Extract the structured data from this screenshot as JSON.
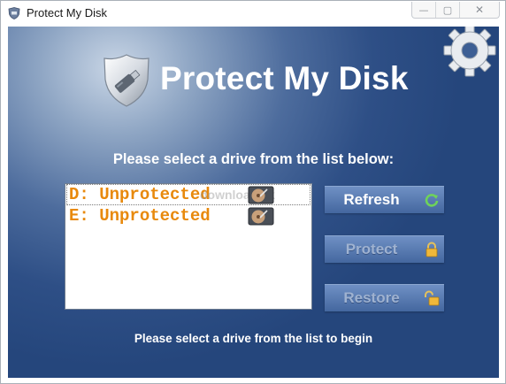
{
  "window": {
    "title": "Protect My Disk",
    "minimize_glyph": "—",
    "maximize_glyph": "▢",
    "close_glyph": "✕"
  },
  "header": {
    "app_name": "Protect My Disk",
    "logo_icon": "shield-usb-icon",
    "settings_icon": "gear-icon"
  },
  "main": {
    "instruction": "Please select a drive from the list below:",
    "drives": [
      {
        "label": "D: Unprotected",
        "icon": "hard-drive-icon",
        "selected": true
      },
      {
        "label": "E: Unprotected",
        "icon": "hard-drive-icon",
        "selected": false
      }
    ],
    "watermark": "download.sk",
    "buttons": {
      "refresh": {
        "label": "Refresh",
        "icon": "refresh-icon",
        "enabled": true
      },
      "protect": {
        "label": "Protect",
        "icon": "lock-closed-icon",
        "enabled": false
      },
      "restore": {
        "label": "Restore",
        "icon": "lock-open-icon",
        "enabled": false
      }
    },
    "status": "Please select a drive from the list to begin"
  },
  "colors": {
    "drive_text": "#e8890c",
    "background_dark": "#25467c",
    "button": "#5b7db3"
  }
}
